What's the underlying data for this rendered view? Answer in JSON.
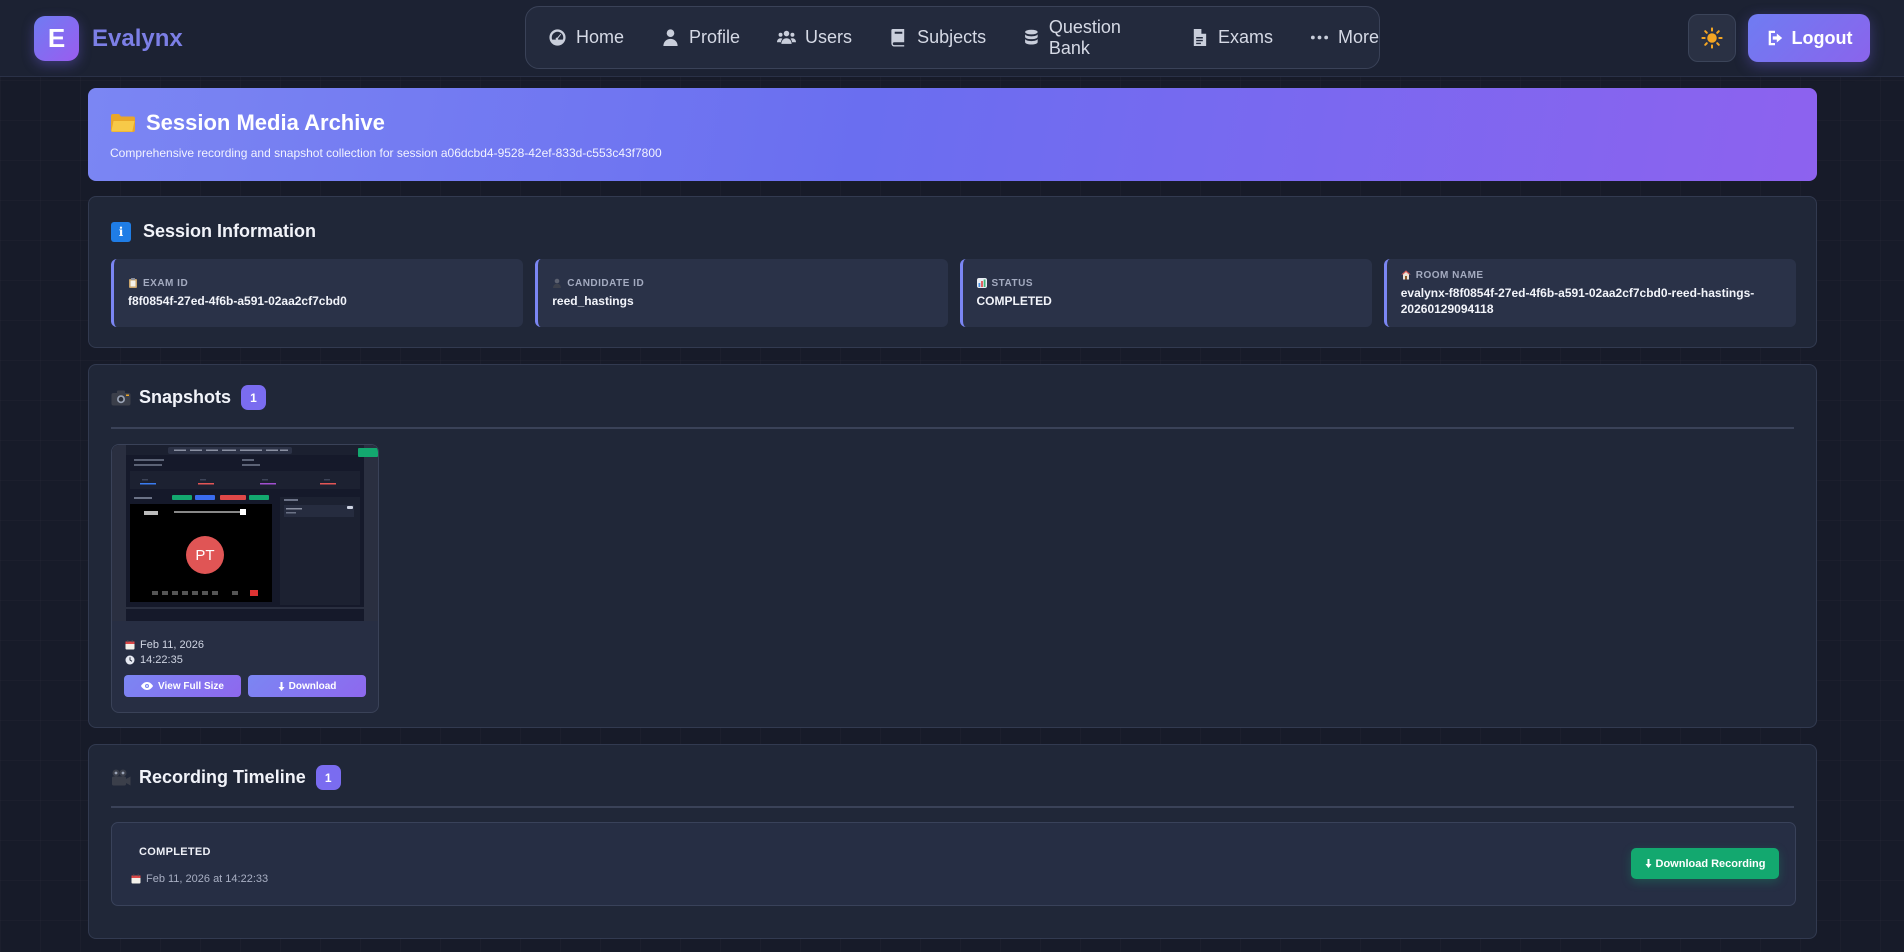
{
  "brand": {
    "logo_letter": "E",
    "name": "Evalynx"
  },
  "nav": [
    {
      "label": "Home",
      "icon": "dashboard-icon"
    },
    {
      "label": "Profile",
      "icon": "user-icon"
    },
    {
      "label": "Users",
      "icon": "users-icon"
    },
    {
      "label": "Subjects",
      "icon": "book-icon"
    },
    {
      "label": "Question Bank",
      "icon": "database-icon"
    },
    {
      "label": "Exams",
      "icon": "file-icon"
    },
    {
      "label": "More",
      "icon": "ellipsis-icon"
    }
  ],
  "header": {
    "theme_toggle_icon": "sun-icon",
    "logout_label": "Logout"
  },
  "hero": {
    "title": "Session Media Archive",
    "subtitle": "Comprehensive recording and snapshot collection for session a06dcbd4-9528-42ef-833d-c553c43f7800"
  },
  "session_info": {
    "title": "Session Information",
    "fields": [
      {
        "label": "EXAM ID",
        "value": "f8f0854f-27ed-4f6b-a591-02aa2cf7cbd0",
        "icon": "clipboard-icon"
      },
      {
        "label": "CANDIDATE ID",
        "value": "reed_hastings",
        "icon": "person-icon"
      },
      {
        "label": "STATUS",
        "value": "COMPLETED",
        "icon": "bar-chart-icon"
      },
      {
        "label": "ROOM NAME",
        "value": "evalynx-f8f0854f-27ed-4f6b-a591-02aa2cf7cbd0-reed-hastings-20260129094118",
        "icon": "house-icon"
      }
    ]
  },
  "snapshots": {
    "title": "Snapshots",
    "count": "1",
    "items": [
      {
        "date": "Feb 11, 2026",
        "time": "14:22:35",
        "thumbnail_initials": "PT",
        "view_label": "View Full Size",
        "download_label": "Download"
      }
    ]
  },
  "recordings": {
    "title": "Recording Timeline",
    "count": "1",
    "items": [
      {
        "status": "COMPLETED",
        "date": "Feb 11, 2026 at 14:22:33",
        "download_label": "Download Recording"
      }
    ]
  },
  "colors": {
    "accent": "#7b86f3",
    "accent_purple": "#8d62ef",
    "success": "#13a86f",
    "background": "#171b29",
    "card": "#202738"
  }
}
